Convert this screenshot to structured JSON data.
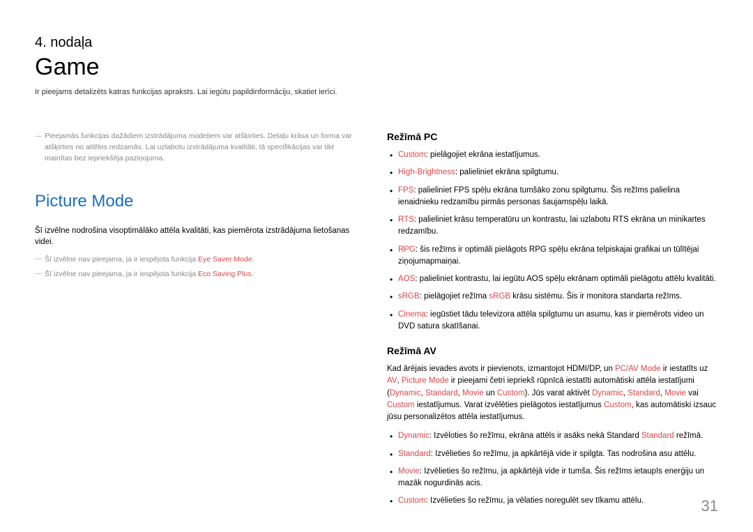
{
  "chapter": {
    "label": "4. nodaļa",
    "title": "Game",
    "description": "Ir pieejams detalizēts katras funkcijas apraksts. Lai iegūtu papildinformāciju, skatiet ierīci."
  },
  "left": {
    "topNote": "Pieejamās funkcijas dažādiem izstrādājuma modeļiem var atšķirties. Detaļu krāsa un forma var atšķirties no attēlos redzamās. Lai uzlabotu izstrādājuma kvalitāti, tā specifikācijas var tikt mainītas bez iepriekšēja paziņojuma.",
    "sectionTitle": "Picture Mode",
    "sectionDesc": "Šī izvēlne nodrošina visoptimālāko attēla kvalitāti, kas piemērota izstrādājuma lietošanas videi.",
    "note1_pre": "Šī izvēlne nav pieejama, ja ir iespējota funkcija ",
    "note1_red": "Eye Saver Mode",
    "note1_post": ".",
    "note2_pre": "Šī izvēlne nav pieejama, ja ir iespējota funkcija ",
    "note2_red": "Eco Saving Plus",
    "note2_post": "."
  },
  "right": {
    "pcHeading": "Režīmā PC",
    "pcItems": {
      "custom_label": "Custom",
      "custom_text": ": pielāgojiet ekrāna iestatījumus.",
      "high_label": "High-Brightness",
      "high_text": ": palieliniet ekrāna spilgtumu.",
      "fps_label": "FPS",
      "fps_text": ": palieliniet FPS spēļu ekrāna tumšāko zonu spilgtumu. Šis režīms palielina ienaidnieku redzamību pirmās personas šaujamspēļu laikā.",
      "rts_label": "RTS",
      "rts_text": ": palieliniet krāsu temperatūru un kontrastu, lai uzlabotu RTS ekrāna un minikartes redzamību.",
      "rpg_label": "RPG",
      "rpg_text": ": šis režīms ir optimāli pielāgots RPG spēļu ekrāna telpiskajai grafikai un tūlītējai ziņojumapmaiņai.",
      "aos_label": "AOS",
      "aos_text": ": palieliniet kontrastu, lai iegūtu AOS spēļu ekrānam optimāli pielāgotu attēlu kvalitāti.",
      "srgb_label": "sRGB",
      "srgb_text1": ": pielāgojiet režīma ",
      "srgb_red": "sRGB",
      "srgb_text2": " krāsu sistēmu. Šis ir monitora standarta režīms.",
      "cinema_label": "Cinema",
      "cinema_text": ": iegūstiet tādu televizora attēla spilgtumu un asumu, kas ir piemērots video un DVD satura skatīšanai."
    },
    "avHeading": "Režīmā AV",
    "avIntro": {
      "t1": "Kad ārējais ievades avots ir pievienots, izmantojot HDMI/DP, un ",
      "r1": "PC/AV Mode",
      "t2": " ir iestatīts uz ",
      "r2": "AV",
      "t3": ", ",
      "r3": "Picture Mode",
      "t4": " ir pieejami četri iepriekš rūpnīcā iestatīti automātiski attēla iestatījumi (",
      "r4": "Dynamic",
      "t5": ", ",
      "r5": "Standard",
      "t6": ", ",
      "r6": "Movie",
      "t7": " un ",
      "r7": "Custom",
      "t8": "). Jūs varat aktivēt ",
      "r8": "Dynamic",
      "t9": ", ",
      "r9": "Standard",
      "t10": ", ",
      "r10": "Movie",
      "t11": " vai ",
      "r11": "Custom",
      "t12": " iestatījumus. Varat izvēlēties pielāgotos iestatījumus ",
      "r12": "Custom",
      "t13": ", kas automātiski izsauc jūsu personalizētos attēla iestatījumus."
    },
    "avItems": {
      "dyn_label": "Dynamic",
      "dyn_t1": ": Izvēloties šo režīmu, ekrāna attēls ir asāks nekā Standard ",
      "dyn_red": "Standard",
      "dyn_t2": " režīmā.",
      "std_label": "Standard",
      "std_text": ": Izvēlieties šo režīmu, ja apkārtējā vide ir spilgta. Tas nodrošina asu attēlu.",
      "mov_label": "Movie",
      "mov_text": ": Izvēlieties šo režīmu, ja apkārtējā vide ir tumša. Šis režīms ietaupīs enerģiju un mazāk nogurdinās acis.",
      "cus_label": "Custom",
      "cus_text": ": Izvēlieties šo režīmu, ja vēlaties noregulēt sev tīkamu attēlu."
    }
  },
  "pageNumber": "31"
}
